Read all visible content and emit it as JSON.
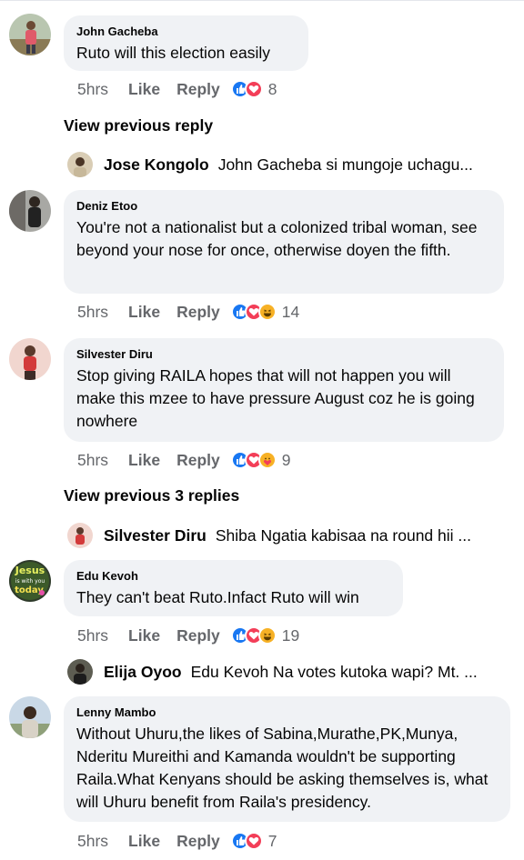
{
  "reaction_colors": {
    "like": "#1877f2",
    "love": "#f33e58",
    "haha": "#f7b125",
    "care": "#f7b125"
  },
  "comments": [
    {
      "author": "John Gacheba",
      "text": "Ruto will this election easily",
      "time": "5hrs",
      "like": "Like",
      "reply": "Reply",
      "reactions": [
        "like",
        "love"
      ],
      "count": "8"
    },
    {
      "author": "Deniz Etoo",
      "text": "You're not a nationalist but a colonized tribal woman, see beyond your nose for once, otherwise doyen the fifth.",
      "time": "5hrs",
      "like": "Like",
      "reply": "Reply",
      "reactions": [
        "like",
        "love",
        "haha"
      ],
      "count": "14"
    },
    {
      "author": "Silvester Diru",
      "text": "Stop giving RAILA hopes that will not happen you will make this mzee to have pressure August coz he is going nowhere",
      "time": "5hrs",
      "like": "Like",
      "reply": "Reply",
      "reactions": [
        "like",
        "love",
        "care"
      ],
      "count": "9"
    },
    {
      "author": "Edu Kevoh",
      "text": "They can't beat Ruto.Infact Ruto will win",
      "time": "5hrs",
      "like": "Like",
      "reply": "Reply",
      "reactions": [
        "like",
        "love",
        "haha"
      ],
      "count": "19"
    },
    {
      "author": "Lenny Mambo",
      "text": "Without Uhuru,the likes of Sabina,Murathe,PK,Munya, Nderitu Mureithi and Kamanda wouldn't be supporting Raila.What Kenyans should be asking themselves is, what will Uhuru benefit from Raila's presidency.",
      "time": "5hrs",
      "like": "Like",
      "reply": "Reply",
      "reactions": [
        "like",
        "love"
      ],
      "count": "7"
    }
  ],
  "view_previous": [
    "View previous reply",
    "View previous 3 replies"
  ],
  "replies": [
    {
      "author": "Jose Kongolo",
      "text": "John Gacheba si mungoje uchagu..."
    },
    {
      "author": "Silvester Diru",
      "text": "Shiba Ngatia kabisaa na round hii ..."
    },
    {
      "author": "Elija Oyoo",
      "text": "Edu Kevoh Na votes kutoka wapi? Mt. ..."
    }
  ],
  "avatar_badge_text": [
    "Jesus",
    "is with you",
    "today"
  ]
}
